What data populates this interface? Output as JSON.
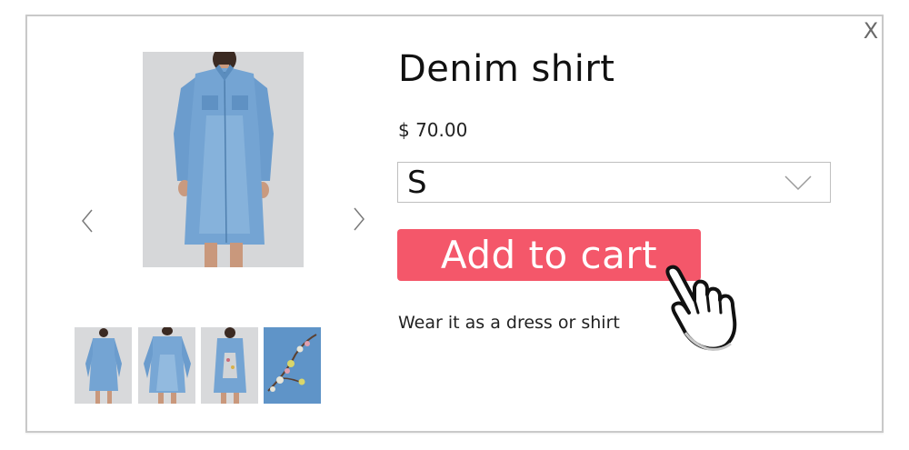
{
  "close_label": "X",
  "product": {
    "title": "Denim shirt",
    "price": "$ 70.00",
    "size_selected": "S",
    "add_to_cart_label": "Add to cart",
    "description": "Wear it as a dress or shirt"
  },
  "gallery": {
    "main_image": "denim-shirt-dress-front",
    "thumbnails": [
      "front-view",
      "front-closeup",
      "back-view",
      "print-detail"
    ]
  },
  "icons": {
    "prev": "chevron-left-icon",
    "next": "chevron-right-icon",
    "dropdown": "chevron-down-icon",
    "cursor": "pointing-hand-icon"
  },
  "colors": {
    "accent": "#f4576a",
    "denim": "#6f9fcf",
    "border": "#c9c9c9"
  }
}
